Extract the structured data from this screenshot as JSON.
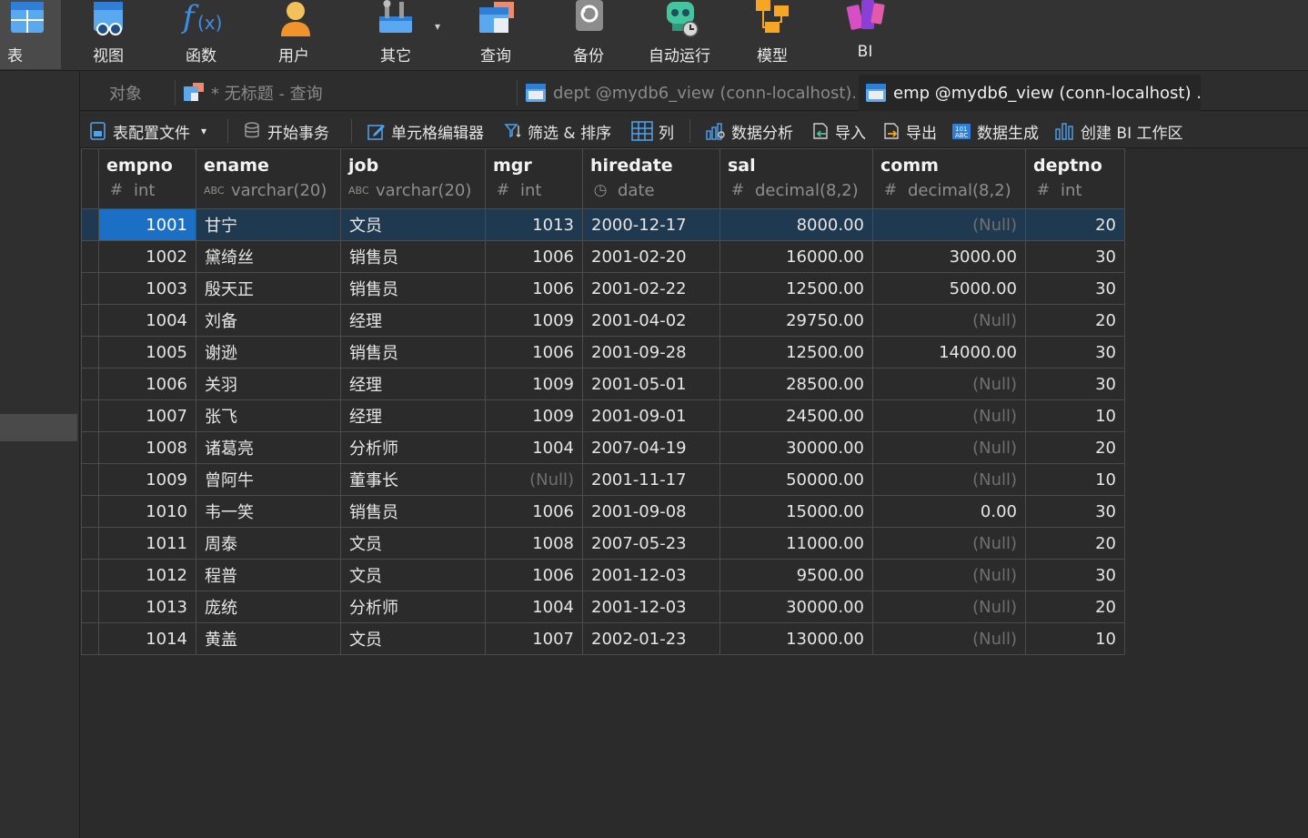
{
  "ribbon": {
    "items": [
      {
        "label": "表",
        "icon": "table-icon"
      },
      {
        "label": "视图",
        "icon": "view-icon"
      },
      {
        "label": "函数",
        "icon": "function-icon"
      },
      {
        "label": "用户",
        "icon": "user-icon"
      },
      {
        "label": "其它",
        "icon": "others-icon"
      },
      {
        "label": "查询",
        "icon": "query-icon"
      },
      {
        "label": "备份",
        "icon": "backup-icon"
      },
      {
        "label": "自动运行",
        "icon": "automation-icon"
      },
      {
        "label": "模型",
        "icon": "model-icon"
      },
      {
        "label": "BI",
        "icon": "bi-icon"
      }
    ],
    "others_dropdown_glyph": "▾"
  },
  "tabs": {
    "objects": "对象",
    "query": "* 无标题 - 查询",
    "dept": "dept @mydb6_view (conn-localhost)...",
    "emp": "emp @mydb6_view (conn-localhost) ..."
  },
  "toolbar": {
    "profile": "表配置文件",
    "profile_dropdown": "▾",
    "begin_tx": "开始事务",
    "cell_editor": "单元格编辑器",
    "filter_sort": "筛选 & 排序",
    "columns": "列",
    "data_analysis": "数据分析",
    "import": "导入",
    "export": "导出",
    "data_gen": "数据生成",
    "create_bi": "创建 BI 工作区"
  },
  "grid": {
    "columns": [
      {
        "name": "empno",
        "type": "int",
        "type_glyph": "#",
        "align": "right"
      },
      {
        "name": "ename",
        "type": "varchar(20)",
        "type_glyph": "ABC",
        "align": "left"
      },
      {
        "name": "job",
        "type": "varchar(20)",
        "type_glyph": "ABC",
        "align": "left"
      },
      {
        "name": "mgr",
        "type": "int",
        "type_glyph": "#",
        "align": "right"
      },
      {
        "name": "hiredate",
        "type": "date",
        "type_glyph": "◷",
        "align": "left"
      },
      {
        "name": "sal",
        "type": "decimal(8,2)",
        "type_glyph": "#",
        "align": "right"
      },
      {
        "name": "comm",
        "type": "decimal(8,2)",
        "type_glyph": "#",
        "align": "right"
      },
      {
        "name": "deptno",
        "type": "int",
        "type_glyph": "#",
        "align": "right"
      }
    ],
    "null_text": "(Null)",
    "rows": [
      [
        "1001",
        "甘宁",
        "文员",
        "1013",
        "2000-12-17",
        "8000.00",
        "(Null)",
        "20"
      ],
      [
        "1002",
        "黛绮丝",
        "销售员",
        "1006",
        "2001-02-20",
        "16000.00",
        "3000.00",
        "30"
      ],
      [
        "1003",
        "殷天正",
        "销售员",
        "1006",
        "2001-02-22",
        "12500.00",
        "5000.00",
        "30"
      ],
      [
        "1004",
        "刘备",
        "经理",
        "1009",
        "2001-04-02",
        "29750.00",
        "(Null)",
        "20"
      ],
      [
        "1005",
        "谢逊",
        "销售员",
        "1006",
        "2001-09-28",
        "12500.00",
        "14000.00",
        "30"
      ],
      [
        "1006",
        "关羽",
        "经理",
        "1009",
        "2001-05-01",
        "28500.00",
        "(Null)",
        "30"
      ],
      [
        "1007",
        "张飞",
        "经理",
        "1009",
        "2001-09-01",
        "24500.00",
        "(Null)",
        "10"
      ],
      [
        "1008",
        "诸葛亮",
        "分析师",
        "1004",
        "2007-04-19",
        "30000.00",
        "(Null)",
        "20"
      ],
      [
        "1009",
        "曾阿牛",
        "董事长",
        "(Null)",
        "2001-11-17",
        "50000.00",
        "(Null)",
        "10"
      ],
      [
        "1010",
        "韦一笑",
        "销售员",
        "1006",
        "2001-09-08",
        "15000.00",
        "0.00",
        "30"
      ],
      [
        "1011",
        "周泰",
        "文员",
        "1008",
        "2007-05-23",
        "11000.00",
        "(Null)",
        "20"
      ],
      [
        "1012",
        "程普",
        "文员",
        "1006",
        "2001-12-03",
        "9500.00",
        "(Null)",
        "30"
      ],
      [
        "1013",
        "庞统",
        "分析师",
        "1004",
        "2001-12-03",
        "30000.00",
        "(Null)",
        "20"
      ],
      [
        "1014",
        "黄盖",
        "文员",
        "1007",
        "2002-01-23",
        "13000.00",
        "(Null)",
        "10"
      ]
    ],
    "selected_row": 0,
    "selected_col": 0
  },
  "colors": {
    "accent": "#1b6fc4",
    "selected_row": "#1f3950",
    "null_text": "#6f6f6f",
    "background": "#2b2b2b"
  }
}
